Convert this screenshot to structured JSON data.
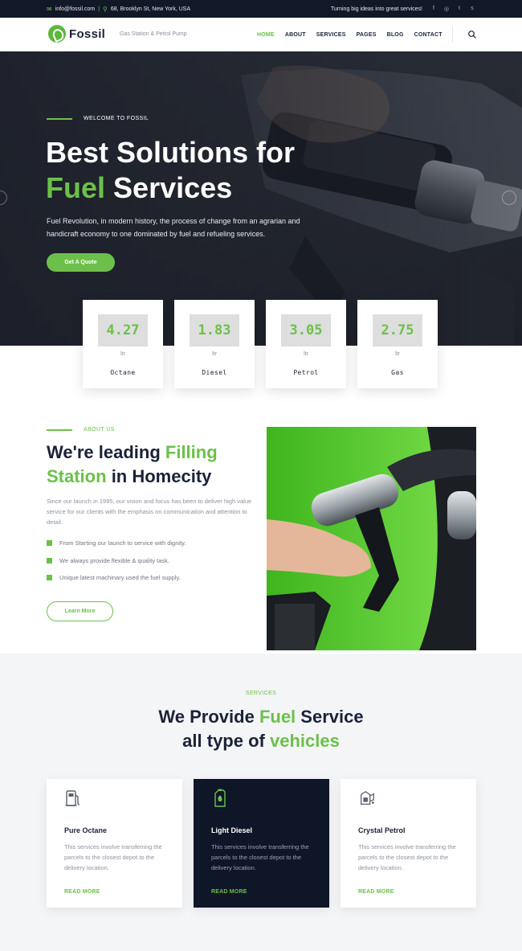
{
  "topbar": {
    "email": "info@fossil.com",
    "address": "68, Brooklyn St, New York, USA",
    "slogan": "Turning big ideas into great services!",
    "social_icons": [
      "facebook-icon",
      "instagram-icon",
      "twitter-icon",
      "skype-icon"
    ]
  },
  "header": {
    "brand": "Fossil",
    "tagline": "Gas Station & Petrol Pump",
    "nav": [
      "HOME",
      "ABOUT",
      "SERVICES",
      "PAGES",
      "BLOG",
      "CONTACT"
    ],
    "active_nav": "HOME"
  },
  "hero": {
    "eyebrow": "WELCOME TO FOSSIL",
    "title_line1": "Best Solutions for",
    "title_green": "Fuel",
    "title_rest": "Services",
    "description": "Fuel Revolution, in modern history, the process of change from an agrarian and handicraft economy to one dominated by fuel and refueling services.",
    "cta": "Get A Quote"
  },
  "prices": [
    {
      "value": "4.27",
      "unit": "ltr",
      "fuel": "Octane"
    },
    {
      "value": "1.83",
      "unit": "ltr",
      "fuel": "Diesel"
    },
    {
      "value": "3.05",
      "unit": "ltr",
      "fuel": "Petrol"
    },
    {
      "value": "2.75",
      "unit": "ltr",
      "fuel": "Gas"
    }
  ],
  "about": {
    "eyebrow": "ABOUT US",
    "title_a": "We're leading",
    "title_b_green": "Filling",
    "title_c_green": "Station",
    "title_d": "in Homecity",
    "text": "Since our launch in 1995, our vision and focus has been to deliver high value service for our clients with the emphasis on communication and attention to detail.",
    "points": [
      "From Starting our launch to service with dignity.",
      "We always provide flexible & quality task.",
      "Unique latest machinary used the fuel supply."
    ],
    "cta": "Learn More"
  },
  "services": {
    "eyebrow": "SERVICES",
    "title_a": "We Provide",
    "title_b_green": "Fuel",
    "title_c": "Service",
    "title_d": "all type of",
    "title_e_green": "vehicles",
    "cards": [
      {
        "title": "Pure Octane",
        "body": "This services involve transferring the parcels to the closest depot to the delivery location.",
        "cta": "READ MORE"
      },
      {
        "title": "Light Diesel",
        "body": "This services involve transferring the parcels to the closest depot to the delivery location.",
        "cta": "READ MORE"
      },
      {
        "title": "Crystal Petrol",
        "body": "This services involve transferring the parcels to the closest depot to the delivery location.",
        "cta": "READ MORE"
      }
    ]
  },
  "colors": {
    "brand_green": "#6cc04a",
    "navy": "#111827",
    "dark_card": "#0f1628"
  }
}
